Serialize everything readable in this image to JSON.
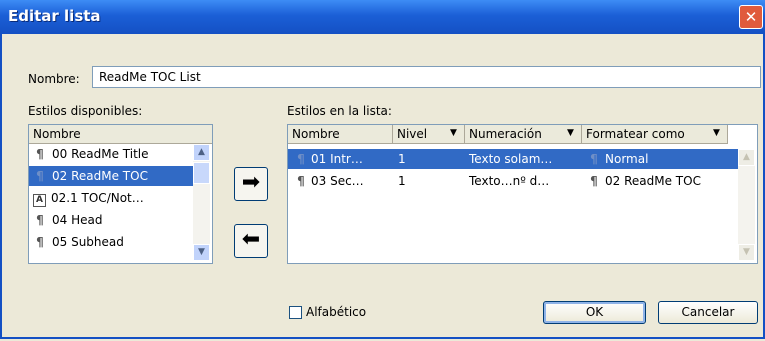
{
  "window": {
    "title": "Editar lista",
    "close_glyph": "✕"
  },
  "name_field": {
    "label": "Nombre:",
    "value": "ReadMe TOC List"
  },
  "available": {
    "label": "Estilos disponibles:",
    "header": "Nombre",
    "items": [
      {
        "icon": "paragraph",
        "text": "00 ReadMe Title",
        "selected": false
      },
      {
        "icon": "paragraph",
        "text": "02 ReadMe TOC",
        "selected": true
      },
      {
        "icon": "character",
        "text": "02.1 TOC/Not…",
        "selected": false
      },
      {
        "icon": "paragraph",
        "text": "04 Head",
        "selected": false
      },
      {
        "icon": "paragraph",
        "text": "05 Subhead",
        "selected": false
      }
    ]
  },
  "in_list": {
    "label": "Estilos en la lista:",
    "headers": {
      "name": "Nombre",
      "level": "Nivel",
      "numbering": "Numeración",
      "format": "Formatear como"
    },
    "rows": [
      {
        "name": "01 Intr…",
        "level": "1",
        "numbering": "Texto solam…",
        "format": "Normal",
        "selected": true
      },
      {
        "name": "03 Sec…",
        "level": "1",
        "numbering": "Texto…nº d…",
        "format": "02 ReadMe TOC",
        "selected": false
      }
    ]
  },
  "glyphs": {
    "paragraph": "¶",
    "character": "A",
    "dropdown": "▼",
    "scroll_up": "▲",
    "scroll_down": "▼",
    "move_right": "➡",
    "move_left": "⬅"
  },
  "alphabetical": {
    "label": "Alfabético",
    "checked": false
  },
  "buttons": {
    "ok": "OK",
    "cancel": "Cancelar"
  },
  "colors": {
    "title_bar": "#1b5fd6",
    "selection": "#316ac5",
    "dialog_bg": "#ece9d8",
    "close_button": "#e05a3c"
  }
}
